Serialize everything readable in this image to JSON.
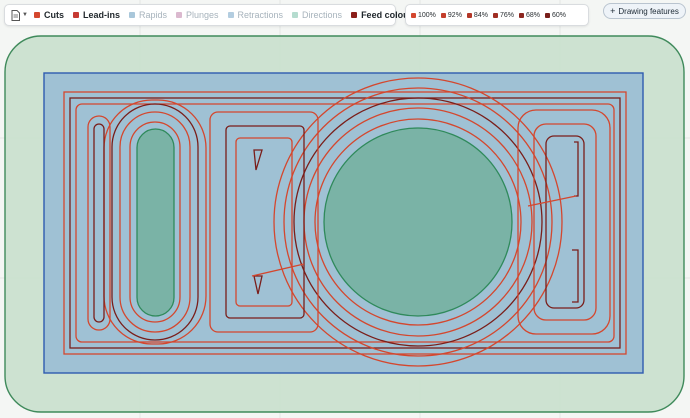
{
  "toolbar": {
    "doc_icon": "document-icon",
    "legend": [
      {
        "label": "Cuts",
        "color": "#d4472e",
        "state": "on"
      },
      {
        "label": "Lead-ins",
        "color": "#c63a33",
        "state": "on"
      },
      {
        "label": "Rapids",
        "color": "#a9c7da",
        "state": "off"
      },
      {
        "label": "Plunges",
        "color": "#dbb9cf",
        "state": "off"
      },
      {
        "label": "Retractions",
        "color": "#b3cde0",
        "state": "off"
      },
      {
        "label": "Directions",
        "color": "#b5dccf",
        "state": "off"
      },
      {
        "label": "Feed colours",
        "color": "#8b1e1a",
        "state": "on"
      }
    ],
    "feed_colours": [
      {
        "label": "100%",
        "color": "#d4472e"
      },
      {
        "label": "92%",
        "color": "#c43e2b"
      },
      {
        "label": "84%",
        "color": "#b33627"
      },
      {
        "label": "76%",
        "color": "#a02e23"
      },
      {
        "label": "68%",
        "color": "#8c261f"
      },
      {
        "label": "60%",
        "color": "#781e1a"
      }
    ],
    "drawing_features_label": "Drawing features"
  },
  "canvas": {
    "stock_color": "#c9e0cd",
    "stock_border": "#3f8a5b",
    "pocket_color": "#9fc1d4",
    "pocket_border": "#2e5bb0",
    "island_color": "#7ab3a6",
    "island_border": "#2f8a5b",
    "cut_color": "#d4472e",
    "slow_cut_color": "#7a1e1a"
  }
}
